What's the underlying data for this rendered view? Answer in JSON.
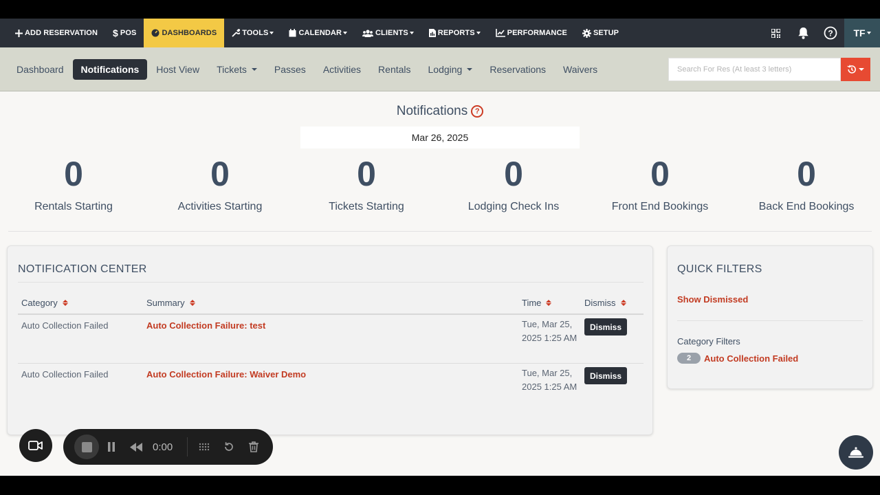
{
  "topnav": {
    "items": [
      {
        "label": "ADD RESERVATION",
        "icon": "plus-icon"
      },
      {
        "label": "POS",
        "icon": "dollar-icon"
      },
      {
        "label": "DASHBOARDS",
        "icon": "dashboard-icon",
        "active": true
      },
      {
        "label": "TOOLS",
        "icon": "wrench-icon",
        "dropdown": true
      },
      {
        "label": "CALENDAR",
        "icon": "calendar-icon",
        "dropdown": true
      },
      {
        "label": "CLIENTS",
        "icon": "users-icon",
        "dropdown": true
      },
      {
        "label": "REPORTS",
        "icon": "report-icon",
        "dropdown": true
      },
      {
        "label": "PERFORMANCE",
        "icon": "chart-line-icon"
      },
      {
        "label": "SETUP",
        "icon": "gear-icon"
      }
    ],
    "user_initials": "TF",
    "accent_color": "#f3c945"
  },
  "subnav": {
    "tabs": [
      {
        "label": "Dashboard"
      },
      {
        "label": "Notifications",
        "active": true
      },
      {
        "label": "Host View"
      },
      {
        "label": "Tickets",
        "dropdown": true
      },
      {
        "label": "Passes"
      },
      {
        "label": "Activities"
      },
      {
        "label": "Rentals"
      },
      {
        "label": "Lodging",
        "dropdown": true
      },
      {
        "label": "Reservations"
      },
      {
        "label": "Waivers"
      }
    ],
    "search_placeholder": "Search For Res (At least 3 letters)"
  },
  "page": {
    "title": "Notifications",
    "date": "Mar 26, 2025"
  },
  "stats": [
    {
      "value": "0",
      "label": "Rentals Starting"
    },
    {
      "value": "0",
      "label": "Activities Starting"
    },
    {
      "value": "0",
      "label": "Tickets Starting"
    },
    {
      "value": "0",
      "label": "Lodging Check Ins"
    },
    {
      "value": "0",
      "label": "Front End Bookings"
    },
    {
      "value": "0",
      "label": "Back End Bookings"
    }
  ],
  "notification_center": {
    "title": "NOTIFICATION CENTER",
    "columns": [
      "Category",
      "Summary",
      "Time",
      "Dismiss"
    ],
    "rows": [
      {
        "category": "Auto Collection Failed",
        "summary": "Auto Collection Failure: test",
        "time": "Tue, Mar 25, 2025 1:25 AM",
        "action": "Dismiss"
      },
      {
        "category": "Auto Collection Failed",
        "summary": "Auto Collection Failure: Waiver Demo",
        "time": "Tue, Mar 25, 2025 1:25 AM",
        "action": "Dismiss"
      }
    ]
  },
  "quick_filters": {
    "title": "QUICK FILTERS",
    "show_dismissed": "Show Dismissed",
    "category_filters_label": "Category Filters",
    "filters": [
      {
        "count": "2",
        "label": "Auto Collection Failed"
      }
    ]
  },
  "recorder": {
    "time": "0:00"
  },
  "colors": {
    "link_red": "#c23b22",
    "dark": "#2b3038",
    "search_button": "#e74a32"
  }
}
